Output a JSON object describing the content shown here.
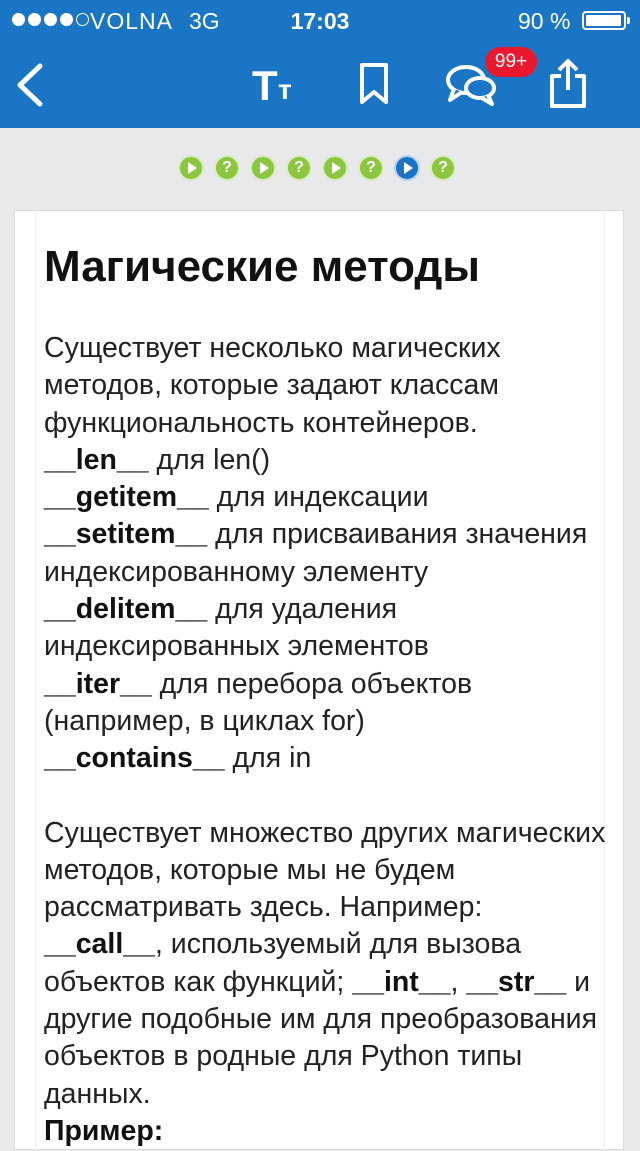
{
  "status_bar": {
    "carrier": "VOLNA",
    "network": "3G",
    "time": "17:03",
    "battery": "90 %"
  },
  "nav": {
    "font_label_big": "T",
    "font_label_small": "т",
    "comments_badge": "99+"
  },
  "steps": [
    "play",
    "?",
    "play",
    "?",
    "play",
    "?",
    "play-active",
    "?"
  ],
  "steps_glyph": "?",
  "lesson": {
    "title": "Магические методы",
    "intro": "Существует несколько магических методов, которые задают классам функциональность контейнеров.",
    "methods": [
      {
        "name": "__len__",
        "desc": " для len()"
      },
      {
        "name": "__getitem__",
        "desc": " для индексации"
      },
      {
        "name": "__setitem__",
        "desc": " для присваивания значения индексированному элементу"
      },
      {
        "name": "__delitem__",
        "desc": " для удаления индексированных элементов"
      },
      {
        "name": "__iter__",
        "desc": " для перебора объектов (например, в циклах for)"
      },
      {
        "name": "__contains__",
        "desc": " для in"
      }
    ],
    "para2_a": "Существует множество других магических методов, которые мы не будем рассматривать здесь. Например: ",
    "para2_call": "__call__",
    "para2_b": ", используемый для вызова объектов как функций; ",
    "para2_int": "__int__",
    "para2_c": ", ",
    "para2_str": "__str__",
    "para2_d": " и другие подобные им для преобразования объектов в родные для Python типы данных.",
    "example_label": "Пример:"
  },
  "colors": {
    "header": "#1a75c4",
    "step_done": "#8cc63f",
    "step_active": "#1a75c4",
    "badge": "#e8192c"
  }
}
